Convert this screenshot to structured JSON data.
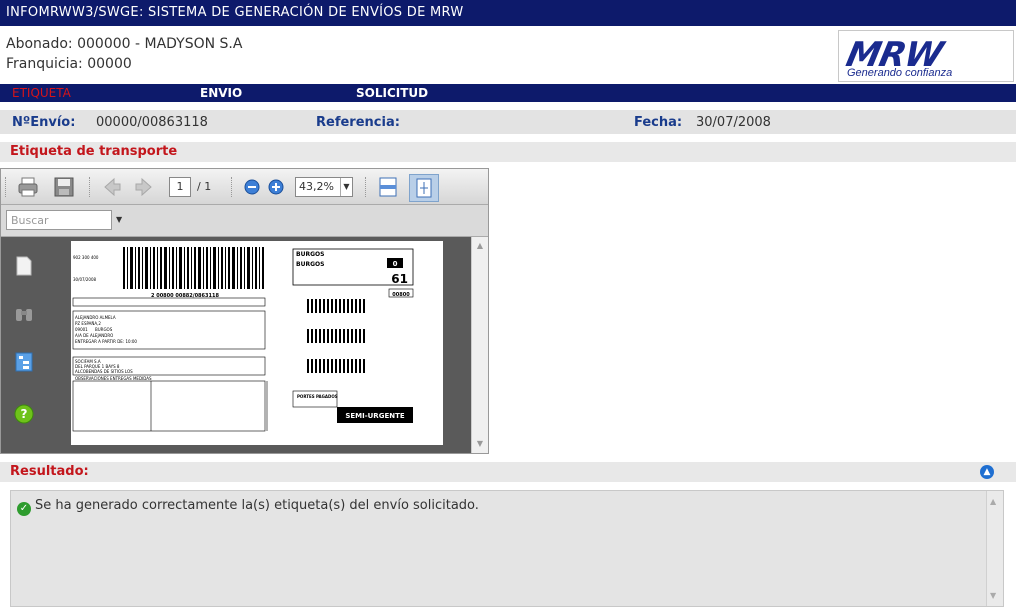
{
  "window": {
    "title": "INFOMRWW3/SWGE: SISTEMA DE GENERACIÓN DE ENVÍOS DE MRW"
  },
  "header": {
    "abonado": "Abonado: 000000 - MADYSON S.A",
    "franquicia": "Franquicia: 00000",
    "logo": {
      "mark": "MRW",
      "tagline": "Generando confianza"
    }
  },
  "menu": {
    "items": [
      {
        "label": "ETIQUETA",
        "active": true
      },
      {
        "label": "ENVIO"
      },
      {
        "label": "SOLICITUD"
      }
    ]
  },
  "info": {
    "envio_label": "NºEnvío:",
    "envio_value": "00000/00863118",
    "referencia_label": "Referencia:",
    "referencia_value": "",
    "fecha_label": "Fecha:",
    "fecha_value": "30/07/2008"
  },
  "section": {
    "title": "Etiqueta de transporte"
  },
  "viewer": {
    "page_current": "1",
    "page_total": "/ 1",
    "zoom": "43,2%",
    "search_placeholder": "Buscar",
    "icons": [
      "print-icon",
      "save-icon",
      "prev-page-icon",
      "next-page-icon",
      "zoom-out-icon",
      "zoom-in-icon",
      "fit-width-icon",
      "fit-page-icon",
      "pages-icon",
      "binoculars-icon",
      "tree-icon",
      "help-icon"
    ]
  },
  "label": {
    "city1": "BURGOS",
    "city2": "BURGOS",
    "box_no": "0",
    "route": "61",
    "office": "00800",
    "service": "SEMI-URGENTE",
    "portes": "PORTES PAGADOS",
    "envio_ref": "2 00800 00882/0863118",
    "dest_name": "ALEJANDRO ALMELA",
    "dest_addr": "PZ ESPAÑA,2",
    "dest_cp": "09001",
    "dest_city": "BURGOS",
    "dest_att": "A/A DE ALEJANDRO",
    "dest_note": "ENTREGAR A PARTIR DE: 10:00",
    "rem_name": "SOCIFAM S.A",
    "rem_addr": "DEL PARQUE 1 BAYS 8",
    "rem_city": "ALCOBENDAS DE SITIOS LOS",
    "obs_header": "OBSERVACIONES ENTREGAS MEDIDAS",
    "phone_line": "902 300 400",
    "date_line": "30/07/2008"
  },
  "result": {
    "title": "Resultado:",
    "message": "Se ha generado correctamente la(s) etiqueta(s) del envío solicitado."
  },
  "colors": {
    "navy": "#0d1a6b",
    "red": "#c3161c",
    "blue_label": "#1a3c8c"
  }
}
